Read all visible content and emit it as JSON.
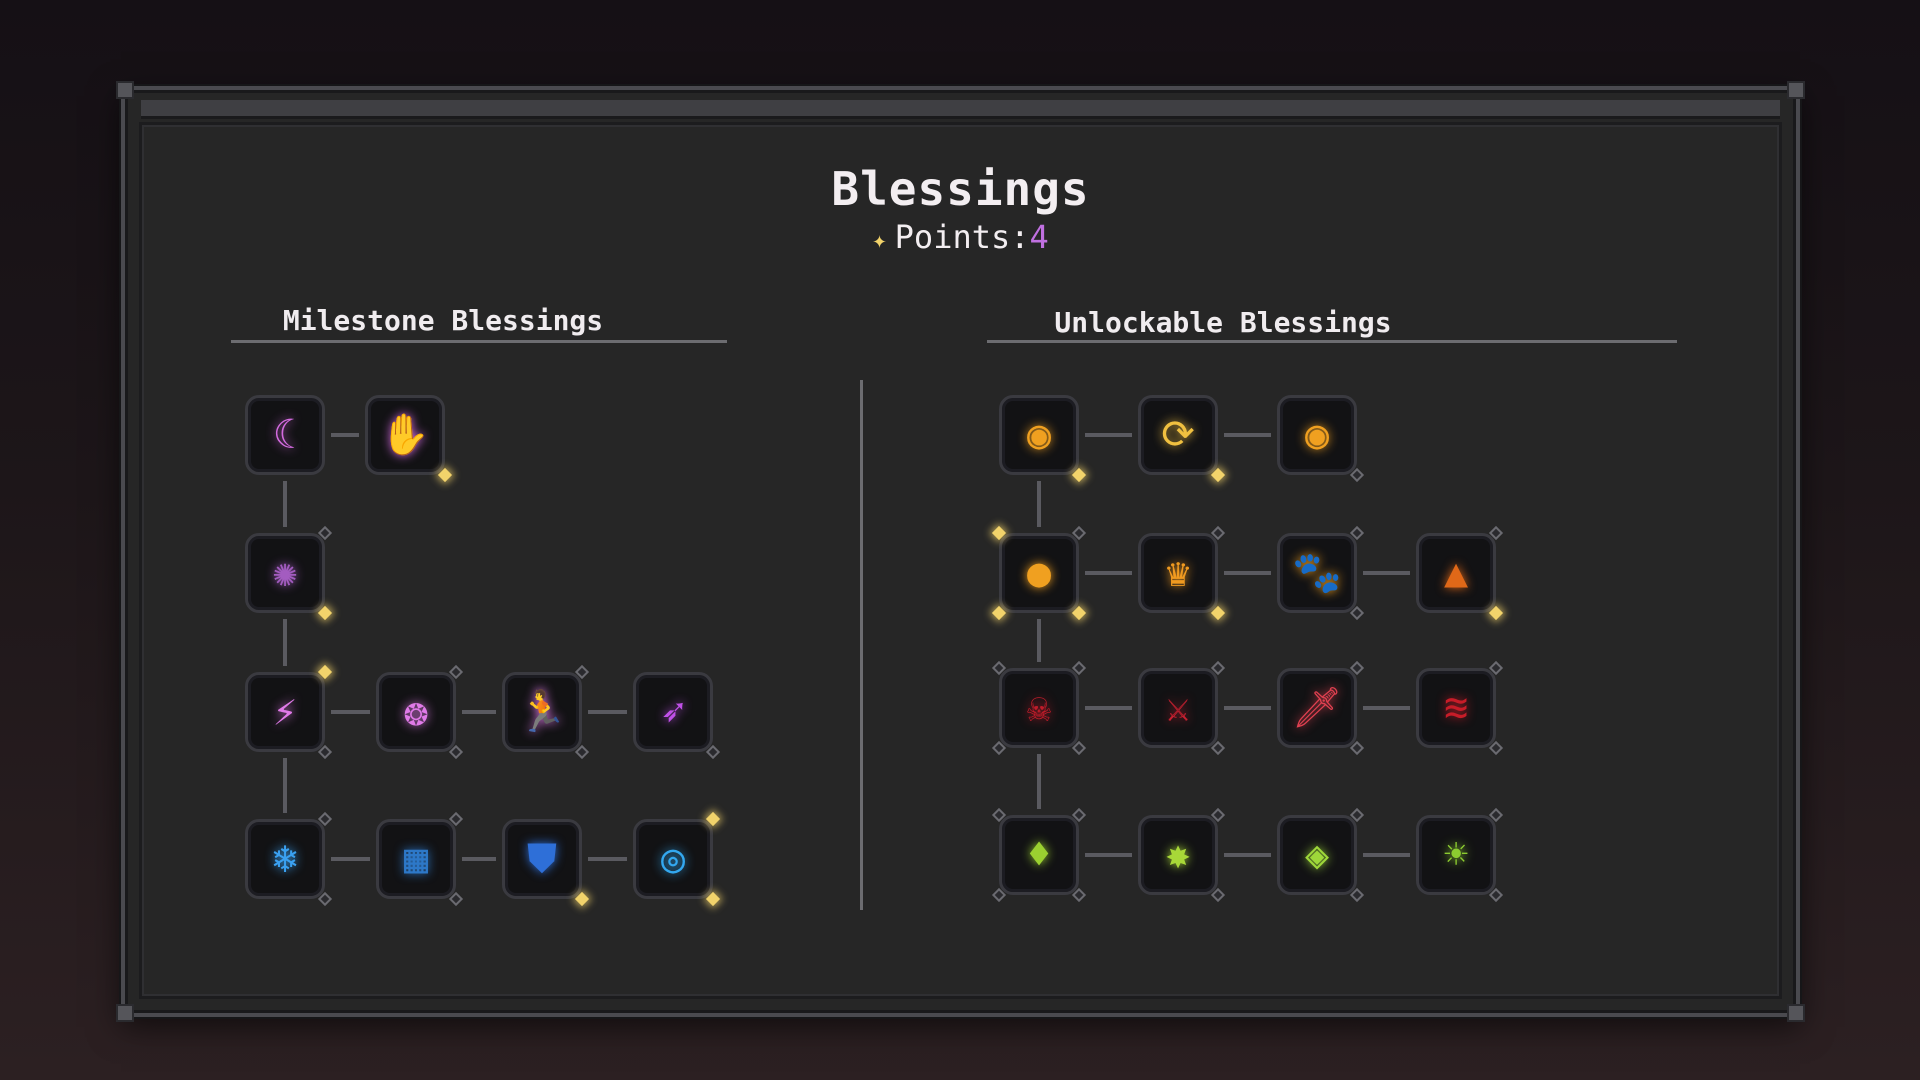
{
  "header": {
    "title": "Blessings",
    "points_label": "Points:",
    "points_value": "4",
    "points_icon": "star-icon"
  },
  "milestone": {
    "title": "Milestone Blessings",
    "nodes": [
      {
        "id": "m1",
        "icon": "crescent-slash-icon",
        "glyph": "☾",
        "color": "#d46be0",
        "markers": []
      },
      {
        "id": "m2",
        "icon": "claw-hand-icon",
        "glyph": "✋",
        "color": "#d46be0",
        "markers": [
          {
            "pos": "br",
            "state": "on"
          }
        ]
      },
      {
        "id": "m3",
        "icon": "cursed-sigil-icon",
        "glyph": "✺",
        "color": "#a35cc0",
        "markers": [
          {
            "pos": "tr",
            "state": "off"
          },
          {
            "pos": "br",
            "state": "on"
          }
        ]
      },
      {
        "id": "m4",
        "icon": "spark-dash-icon",
        "glyph": "⚡",
        "color": "#e07ae8",
        "markers": [
          {
            "pos": "tr",
            "state": "on"
          },
          {
            "pos": "br",
            "state": "off"
          }
        ]
      },
      {
        "id": "m5",
        "icon": "orb-burst-icon",
        "glyph": "❂",
        "color": "#e07ae8",
        "markers": [
          {
            "pos": "tr",
            "state": "off"
          },
          {
            "pos": "br",
            "state": "off"
          }
        ]
      },
      {
        "id": "m6",
        "icon": "sprint-icon",
        "glyph": "🏃",
        "color": "#e07ae8",
        "markers": [
          {
            "pos": "tr",
            "state": "off"
          },
          {
            "pos": "br",
            "state": "off"
          }
        ]
      },
      {
        "id": "m7",
        "icon": "arcane-wing-icon",
        "glyph": "➶",
        "color": "#c050e8",
        "markers": [
          {
            "pos": "br",
            "state": "off"
          }
        ]
      },
      {
        "id": "m8",
        "icon": "ice-crystal-icon",
        "glyph": "❄",
        "color": "#3aa0f0",
        "markers": [
          {
            "pos": "tr",
            "state": "off"
          },
          {
            "pos": "br",
            "state": "off"
          }
        ]
      },
      {
        "id": "m9",
        "icon": "rune-grid-icon",
        "glyph": "▦",
        "color": "#2d78c8",
        "markers": [
          {
            "pos": "tr",
            "state": "off"
          },
          {
            "pos": "br",
            "state": "off"
          }
        ]
      },
      {
        "id": "m10",
        "icon": "shield-icon",
        "glyph": "⛊",
        "color": "#2e6fd8",
        "markers": [
          {
            "pos": "br",
            "state": "on"
          }
        ]
      },
      {
        "id": "m11",
        "icon": "vortex-icon",
        "glyph": "◎",
        "color": "#33a8f0",
        "markers": [
          {
            "pos": "tr",
            "state": "on"
          },
          {
            "pos": "br",
            "state": "on"
          }
        ]
      }
    ]
  },
  "unlockable": {
    "title": "Unlockable Blessings",
    "nodes": [
      {
        "id": "u1",
        "icon": "fiery-eye-icon",
        "glyph": "◉",
        "color": "#f0a020",
        "markers": [
          {
            "pos": "br",
            "state": "on"
          }
        ]
      },
      {
        "id": "u2",
        "icon": "cycle-icon",
        "glyph": "⟳",
        "color": "#f0c040",
        "markers": [
          {
            "pos": "br",
            "state": "on"
          }
        ]
      },
      {
        "id": "u3",
        "icon": "fiery-eye-icon",
        "glyph": "◉",
        "color": "#f0a020",
        "markers": [
          {
            "pos": "br",
            "state": "off"
          }
        ]
      },
      {
        "id": "u4",
        "icon": "fire-orb-icon",
        "glyph": "●",
        "color": "#f0a020",
        "markers": [
          {
            "pos": "tl",
            "state": "on"
          },
          {
            "pos": "tr",
            "state": "off"
          },
          {
            "pos": "bl",
            "state": "on"
          },
          {
            "pos": "br",
            "state": "on"
          }
        ]
      },
      {
        "id": "u5",
        "icon": "flame-crown-icon",
        "glyph": "♛",
        "color": "#f09a20",
        "markers": [
          {
            "pos": "tr",
            "state": "off"
          },
          {
            "pos": "br",
            "state": "on"
          }
        ]
      },
      {
        "id": "u6",
        "icon": "paw-icon",
        "glyph": "🐾",
        "color": "#f0a020",
        "markers": [
          {
            "pos": "tr",
            "state": "off"
          },
          {
            "pos": "br",
            "state": "off"
          }
        ]
      },
      {
        "id": "u7",
        "icon": "inferno-icon",
        "glyph": "▲",
        "color": "#e06818",
        "markers": [
          {
            "pos": "tr",
            "state": "off"
          },
          {
            "pos": "br",
            "state": "on"
          }
        ]
      },
      {
        "id": "u8",
        "icon": "demon-face-icon",
        "glyph": "☠",
        "color": "#c01c2a",
        "markers": [
          {
            "pos": "tl",
            "state": "off"
          },
          {
            "pos": "tr",
            "state": "off"
          },
          {
            "pos": "bl",
            "state": "off"
          },
          {
            "pos": "br",
            "state": "off"
          }
        ]
      },
      {
        "id": "u9",
        "icon": "blood-blade-icon",
        "glyph": "⚔",
        "color": "#c82030",
        "markers": [
          {
            "pos": "tr",
            "state": "off"
          },
          {
            "pos": "br",
            "state": "off"
          }
        ]
      },
      {
        "id": "u10",
        "icon": "blade-icon",
        "glyph": "🗡",
        "color": "#e04050",
        "markers": [
          {
            "pos": "tr",
            "state": "off"
          },
          {
            "pos": "br",
            "state": "off"
          }
        ]
      },
      {
        "id": "u11",
        "icon": "claw-marks-icon",
        "glyph": "≋",
        "color": "#c81c28",
        "markers": [
          {
            "pos": "tr",
            "state": "off"
          },
          {
            "pos": "br",
            "state": "off"
          }
        ]
      },
      {
        "id": "u12",
        "icon": "poison-drop-icon",
        "glyph": "♦",
        "color": "#9ad030",
        "markers": [
          {
            "pos": "tl",
            "state": "off"
          },
          {
            "pos": "tr",
            "state": "off"
          },
          {
            "pos": "bl",
            "state": "off"
          },
          {
            "pos": "br",
            "state": "off"
          }
        ]
      },
      {
        "id": "u13",
        "icon": "toxic-strike-icon",
        "glyph": "✸",
        "color": "#a8d838",
        "markers": [
          {
            "pos": "tr",
            "state": "off"
          },
          {
            "pos": "br",
            "state": "off"
          }
        ]
      },
      {
        "id": "u14",
        "icon": "toxic-eye-icon",
        "glyph": "◈",
        "color": "#9ed83a",
        "markers": [
          {
            "pos": "tr",
            "state": "off"
          },
          {
            "pos": "br",
            "state": "off"
          }
        ]
      },
      {
        "id": "u15",
        "icon": "toxic-sun-icon",
        "glyph": "☀",
        "color": "#8ccc30",
        "markers": [
          {
            "pos": "tr",
            "state": "off"
          },
          {
            "pos": "br",
            "state": "off"
          }
        ]
      }
    ]
  }
}
